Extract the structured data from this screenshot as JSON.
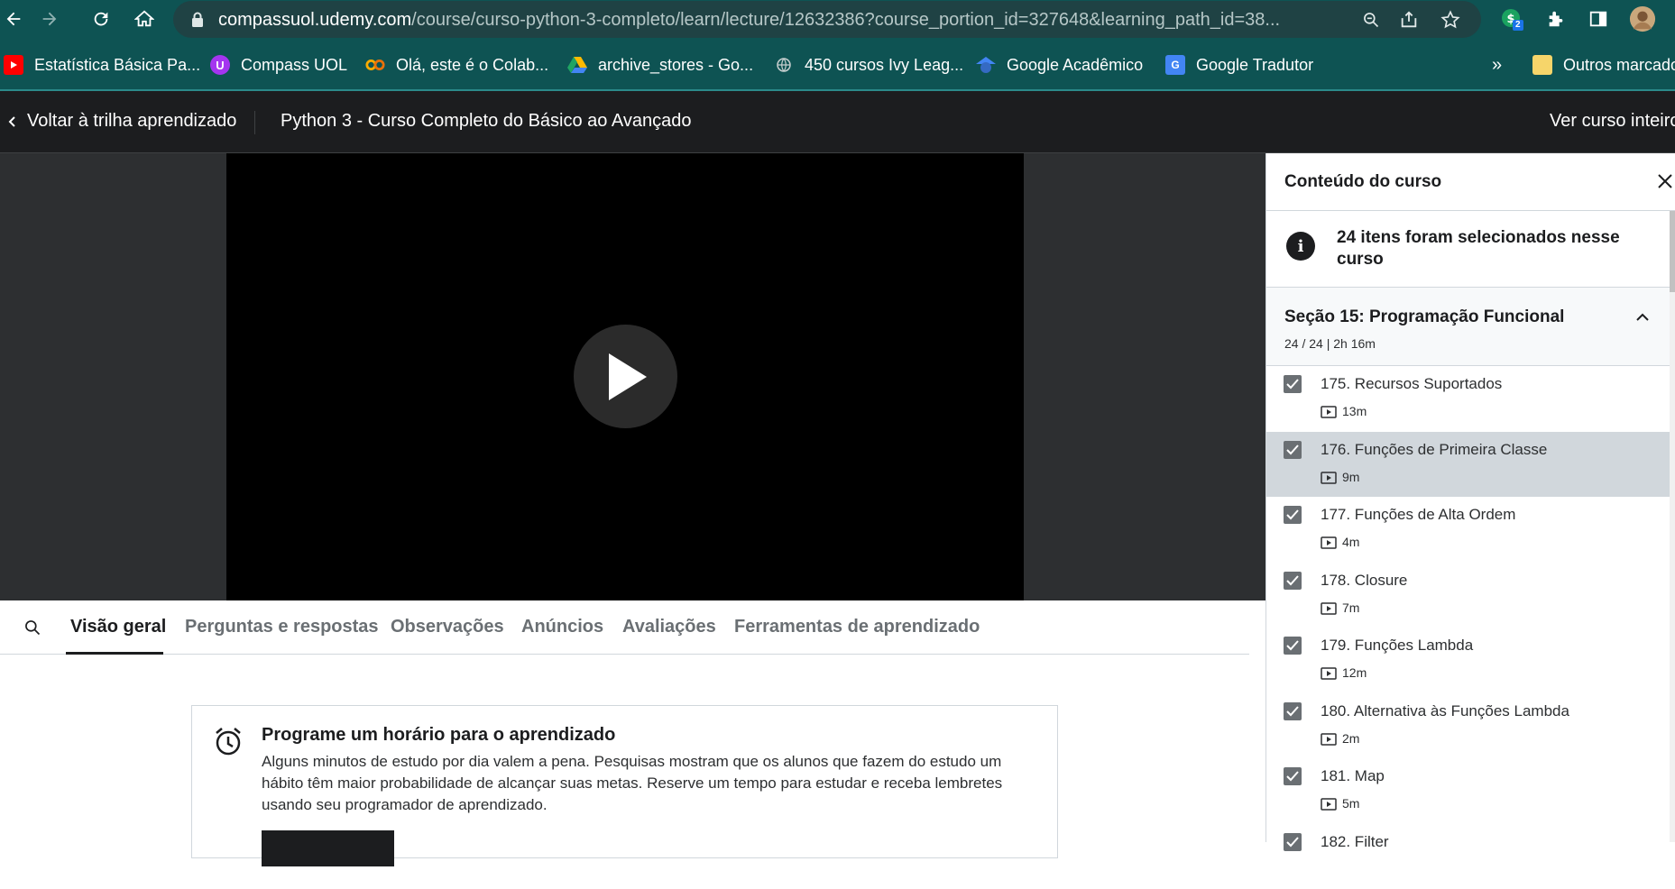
{
  "browser": {
    "url_host": "compassuol.udemy.com",
    "url_path": "/course/curso-python-3-completo/learn/lecture/12632386?course_portion_id=327648&learning_path_id=38...",
    "extension_badge": "2",
    "bookmarks": [
      {
        "label": "Estatística Básica Pa...",
        "icon": "youtube-icon",
        "color": "#ff0000"
      },
      {
        "label": "Compass UOL",
        "icon": "udemy-icon",
        "color": "#a435f0"
      },
      {
        "label": "Olá, este é o Colab...",
        "icon": "colab-icon",
        "color": "#f9ab00"
      },
      {
        "label": "archive_stores - Go...",
        "icon": "drive-icon",
        "color": "#1fa463"
      },
      {
        "label": "450 cursos Ivy Leag...",
        "icon": "globe-icon",
        "color": "#9aa0a6"
      },
      {
        "label": "Google Acadêmico",
        "icon": "scholar-icon",
        "color": "#4285f4"
      },
      {
        "label": "Google Tradutor",
        "icon": "translate-icon",
        "color": "#4285f4"
      }
    ],
    "more_bookmarks": "»",
    "other_bookmarks": "Outros marcadores"
  },
  "header": {
    "back_label": "Voltar à trilha aprendizado",
    "course_title": "Python 3 - Curso Completo do Básico ao Avançado",
    "full_course_label": "Ver curso inteiro"
  },
  "tabs": [
    {
      "label": "Visão geral",
      "active": true
    },
    {
      "label": "Perguntas e respostas"
    },
    {
      "label": "Observações"
    },
    {
      "label": "Anúncios"
    },
    {
      "label": "Avaliações"
    },
    {
      "label": "Ferramentas de aprendizado"
    }
  ],
  "scheduler": {
    "title": "Programe um horário para o aprendizado",
    "text": "Alguns minutos de estudo por dia valem a pena. Pesquisas mostram que os alunos que fazem do estudo um hábito têm maior probabilidade de alcançar suas metas. Reserve um tempo para estudar e receba lembretes usando seu programador de aprendizado."
  },
  "sidebar": {
    "title": "Conteúdo do curso",
    "info": "24 itens foram selecionados nesse curso",
    "section_title": "Seção 15: Programação Funcional",
    "section_meta": "24 / 24 | 2h 16m",
    "lectures": [
      {
        "title": "175. Recursos Suportados",
        "duration": "13m"
      },
      {
        "title": "176. Funções de Primeira Classe",
        "duration": "9m",
        "current": true
      },
      {
        "title": "177. Funções de Alta Ordem",
        "duration": "4m"
      },
      {
        "title": "178. Closure",
        "duration": "7m"
      },
      {
        "title": "179. Funções Lambda",
        "duration": "12m"
      },
      {
        "title": "180. Alternativa às Funções Lambda",
        "duration": "2m"
      },
      {
        "title": "181. Map",
        "duration": "5m"
      },
      {
        "title": "182. Filter",
        "duration": ""
      }
    ]
  }
}
